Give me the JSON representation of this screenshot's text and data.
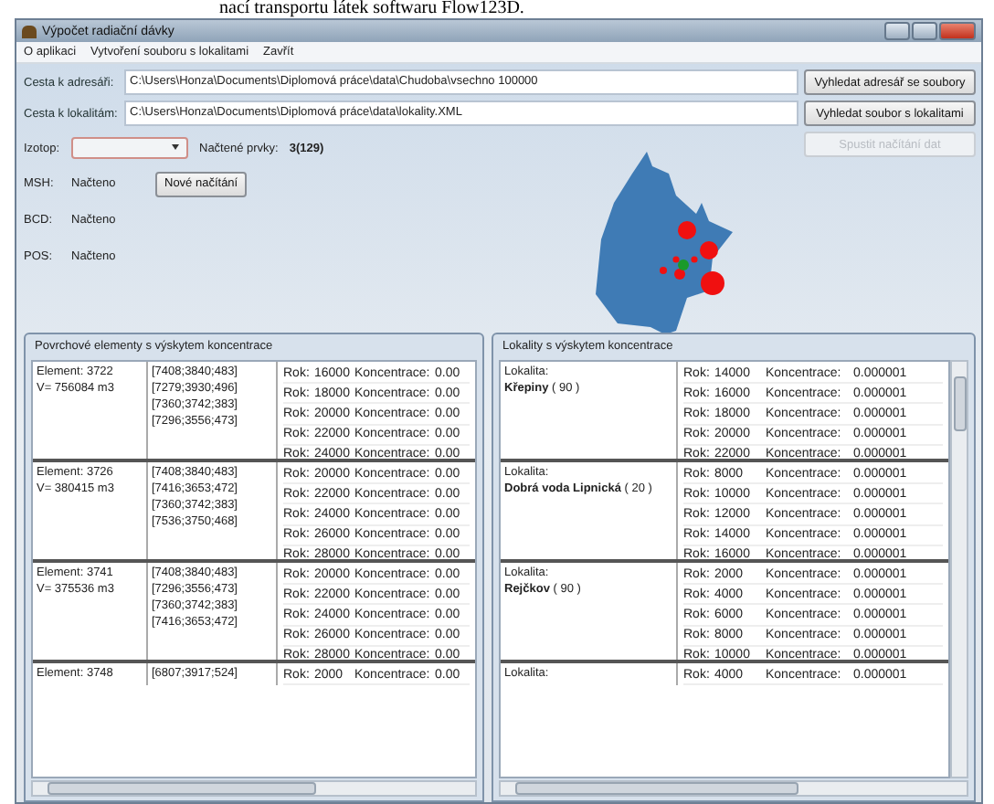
{
  "document_caption": "nací transportu látek softwaru Flow123D.",
  "window": {
    "title": "Výpočet radiační dávky"
  },
  "menu": [
    "O aplikaci",
    "Vytvoření souboru s lokalitami",
    "Zavřít"
  ],
  "paths": [
    {
      "label": "Cesta k adresáři:",
      "value": "C:\\Users\\Honza\\Documents\\Diplomová práce\\data\\Chudoba\\vsechno 100000",
      "button": "Vyhledat adresář se soubory"
    },
    {
      "label": "Cesta k lokalitám:",
      "value": "C:\\Users\\Honza\\Documents\\Diplomová práce\\data\\lokality.XML",
      "button": "Vyhledat soubor s lokalitami"
    }
  ],
  "isotope": {
    "label": "Izotop:"
  },
  "loaded_elements": {
    "label": "Načtené prvky:",
    "value": "3(129)"
  },
  "start_button": {
    "label": "Spustit načítání dat",
    "disabled": true
  },
  "reload_button": {
    "label": "Nové načítání",
    "disabled": false
  },
  "status": [
    {
      "label": "MSH:",
      "value": "Načteno"
    },
    {
      "label": "BCD:",
      "value": "Načteno"
    },
    {
      "label": "POS:",
      "value": "Načteno"
    }
  ],
  "elements_panel": {
    "title": "Povrchové elementy s výskytem koncentrace",
    "items": [
      {
        "element": "Element: 3722",
        "volume": "V= 756084 m3",
        "coords": [
          "[7408;3840;483]",
          "[7279;3930;496]",
          "[7360;3742;383]",
          "[7296;3556;473]"
        ],
        "rows": [
          [
            "Rok:",
            "16000",
            "Koncentrace:",
            "0.00"
          ],
          [
            "Rok:",
            "18000",
            "Koncentrace:",
            "0.00"
          ],
          [
            "Rok:",
            "20000",
            "Koncentrace:",
            "0.00"
          ],
          [
            "Rok:",
            "22000",
            "Koncentrace:",
            "0.00"
          ],
          [
            "Rok:",
            "24000",
            "Koncentrace:",
            "0.00"
          ]
        ]
      },
      {
        "element": "Element: 3726",
        "volume": "V= 380415 m3",
        "coords": [
          "[7408;3840;483]",
          "[7416;3653;472]",
          "[7360;3742;383]",
          "[7536;3750;468]"
        ],
        "rows": [
          [
            "Rok:",
            "20000",
            "Koncentrace:",
            "0.00"
          ],
          [
            "Rok:",
            "22000",
            "Koncentrace:",
            "0.00"
          ],
          [
            "Rok:",
            "24000",
            "Koncentrace:",
            "0.00"
          ],
          [
            "Rok:",
            "26000",
            "Koncentrace:",
            "0.00"
          ],
          [
            "Rok:",
            "28000",
            "Koncentrace:",
            "0.00"
          ]
        ]
      },
      {
        "element": "Element: 3741",
        "volume": "V= 375536 m3",
        "coords": [
          "[7408;3840;483]",
          "[7296;3556;473]",
          "[7360;3742;383]",
          "[7416;3653;472]"
        ],
        "rows": [
          [
            "Rok:",
            "20000",
            "Koncentrace:",
            "0.00"
          ],
          [
            "Rok:",
            "22000",
            "Koncentrace:",
            "0.00"
          ],
          [
            "Rok:",
            "24000",
            "Koncentrace:",
            "0.00"
          ],
          [
            "Rok:",
            "26000",
            "Koncentrace:",
            "0.00"
          ],
          [
            "Rok:",
            "28000",
            "Koncentrace:",
            "0.00"
          ]
        ]
      },
      {
        "element": "Element: 3748",
        "coords": [
          "[6807;3917;524]"
        ],
        "rows": [
          [
            "Rok:",
            "2000",
            "Koncentrace:",
            "0.00"
          ]
        ]
      }
    ]
  },
  "localities_panel": {
    "title": "Lokality s výskytem koncentrace",
    "items": [
      {
        "label": "Lokalita:",
        "name": "**Křepiny** ( 90 )",
        "rows": [
          [
            "Rok:",
            "14000",
            "Koncentrace:",
            "0.000001"
          ],
          [
            "Rok:",
            "16000",
            "Koncentrace:",
            "0.000001"
          ],
          [
            "Rok:",
            "18000",
            "Koncentrace:",
            "0.000001"
          ],
          [
            "Rok:",
            "20000",
            "Koncentrace:",
            "0.000001"
          ],
          [
            "Rok:",
            "22000",
            "Koncentrace:",
            "0.000001"
          ]
        ]
      },
      {
        "label": "Lokalita:",
        "name": "**Dobrá voda Lipnická** ( 20 )",
        "rows": [
          [
            "Rok:",
            "8000",
            "Koncentrace:",
            "0.000001"
          ],
          [
            "Rok:",
            "10000",
            "Koncentrace:",
            "0.000001"
          ],
          [
            "Rok:",
            "12000",
            "Koncentrace:",
            "0.000001"
          ],
          [
            "Rok:",
            "14000",
            "Koncentrace:",
            "0.000001"
          ],
          [
            "Rok:",
            "16000",
            "Koncentrace:",
            "0.000001"
          ]
        ]
      },
      {
        "label": "Lokalita:",
        "name": "**Rejčkov** ( 90 )",
        "rows": [
          [
            "Rok:",
            "2000",
            "Koncentrace:",
            "0.000001"
          ],
          [
            "Rok:",
            "4000",
            "Koncentrace:",
            "0.000001"
          ],
          [
            "Rok:",
            "6000",
            "Koncentrace:",
            "0.000001"
          ],
          [
            "Rok:",
            "8000",
            "Koncentrace:",
            "0.000001"
          ],
          [
            "Rok:",
            "10000",
            "Koncentrace:",
            "0.000001"
          ]
        ]
      },
      {
        "label": "Lokalita:",
        "rows": [
          [
            "Rok:",
            "4000",
            "Koncentrace:",
            "0.000001"
          ]
        ]
      }
    ]
  }
}
